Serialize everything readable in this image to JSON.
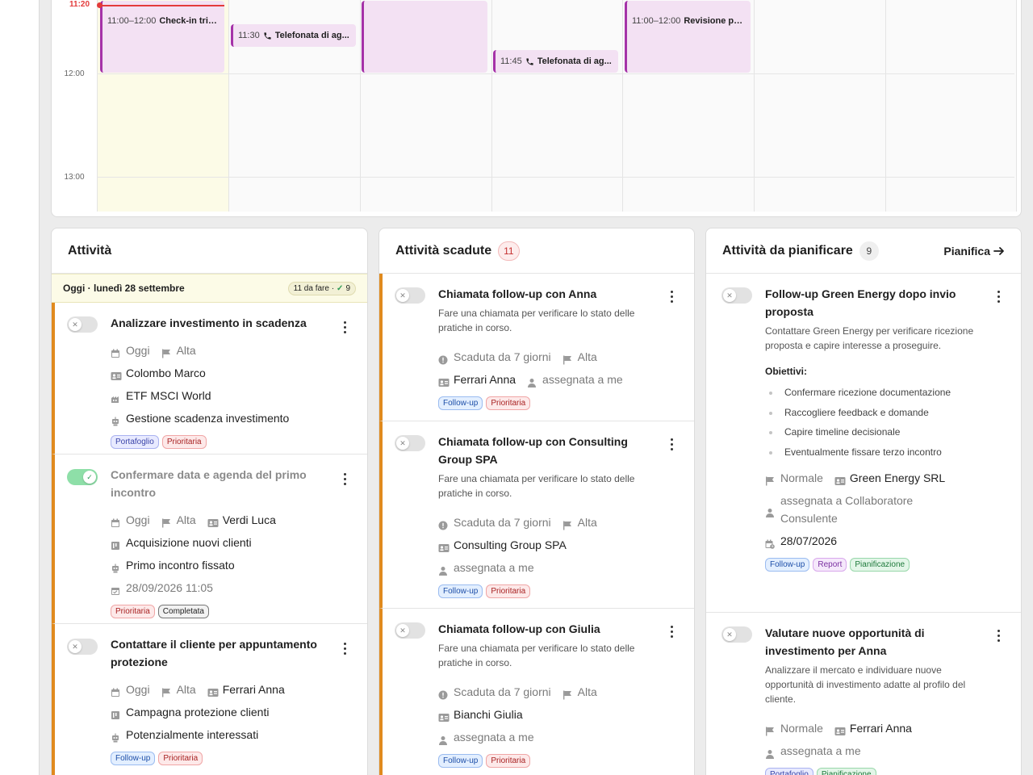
{
  "calendar": {
    "now_label": "11:20",
    "hours": [
      "12:00",
      "13:00"
    ],
    "events": [
      {
        "time": "11:00–12:00",
        "name": "Check-in trim..."
      },
      {
        "time": "11:30",
        "name": "Telefonata di ag..."
      },
      {
        "time": "",
        "name": ""
      },
      {
        "time": "11:45",
        "name": "Telefonata di ag..."
      },
      {
        "time": "11:00–12:00",
        "name": "Revisione por..."
      }
    ]
  },
  "attivita": {
    "title": "Attività",
    "today": "Oggi · lunedì 28 settembre",
    "todo": "11 da fare ·",
    "done_count": "9",
    "tasks": [
      {
        "title": "Analizzare investimento in scadenza",
        "date": "Oggi",
        "priority": "Alta",
        "contact": "Colombo Marco",
        "product": "ETF MSCI World",
        "process": "Gestione scadenza investimento",
        "tags": [
          "Portafoglio",
          "Prioritaria"
        ]
      },
      {
        "title": "Confermare data e agenda del primo incontro",
        "date": "Oggi",
        "priority": "Alta",
        "contact": "Verdi Luca",
        "campaign": "Acquisizione nuovi clienti",
        "process": "Primo incontro fissato",
        "completed_at": "28/09/2026 11:05",
        "tags": [
          "Prioritaria",
          "Completata"
        ]
      },
      {
        "title": "Contattare il cliente per appuntamento protezione",
        "date": "Oggi",
        "priority": "Alta",
        "contact": "Ferrari Anna",
        "campaign": "Campagna protezione clienti",
        "process": "Potenzialmente interessati",
        "tags": [
          "Follow-up",
          "Prioritaria"
        ]
      }
    ]
  },
  "scadute": {
    "title": "Attività scadute",
    "count": "11",
    "tasks": [
      {
        "title": "Chiamata follow-up con Anna",
        "desc": "Fare una chiamata per verificare lo stato delle pratiche in corso.",
        "overdue": "Scaduta da 7 giorni",
        "priority": "Alta",
        "contact": "Ferrari Anna",
        "assignee": "assegnata a me",
        "tags": [
          "Follow-up",
          "Prioritaria"
        ]
      },
      {
        "title": "Chiamata follow-up con Consulting Group SPA",
        "desc": "Fare una chiamata per verificare lo stato delle pratiche in corso.",
        "overdue": "Scaduta da 7 giorni",
        "priority": "Alta",
        "contact": "Consulting Group SPA",
        "assignee": "assegnata a me",
        "tags": [
          "Follow-up",
          "Prioritaria"
        ]
      },
      {
        "title": "Chiamata follow-up con Giulia",
        "desc": "Fare una chiamata per verificare lo stato delle pratiche in corso.",
        "overdue": "Scaduta da 7 giorni",
        "priority": "Alta",
        "contact": "Bianchi Giulia",
        "assignee": "assegnata a me",
        "tags": [
          "Follow-up",
          "Prioritaria"
        ]
      }
    ]
  },
  "pianificare": {
    "title": "Attività da pianificare",
    "count": "9",
    "action": "Pianifica",
    "tasks": [
      {
        "title": "Follow-up Green Energy dopo invio proposta",
        "desc": "Contattare Green Energy per verificare ricezione proposta e capire interesse a proseguire.",
        "objectives_title": "Obiettivi:",
        "objectives": [
          "Confermare ricezione documentazione",
          "Raccogliere feedback e domande",
          "Capire timeline decisionale",
          "Eventualmente fissare terzo incontro"
        ],
        "priority": "Normale",
        "contact": "Green Energy SRL",
        "assignee": "assegnata a Collaboratore Consulente",
        "due": "28/07/2026",
        "tags": [
          "Follow-up",
          "Report",
          "Pianificazione"
        ]
      },
      {
        "title": "Valutare nuove opportunità di investimento per Anna",
        "desc": "Analizzare il mercato e individuare nuove opportunità di investimento adatte al profilo del cliente.",
        "priority": "Normale",
        "contact": "Ferrari Anna",
        "assignee": "assegnata a me",
        "tags": [
          "Portafoglio",
          "Pianificazione"
        ]
      }
    ]
  },
  "colors": {
    "accent_orange": "#e08a1e",
    "event_purple": "#a532a8",
    "now_red": "#e33b3b"
  }
}
